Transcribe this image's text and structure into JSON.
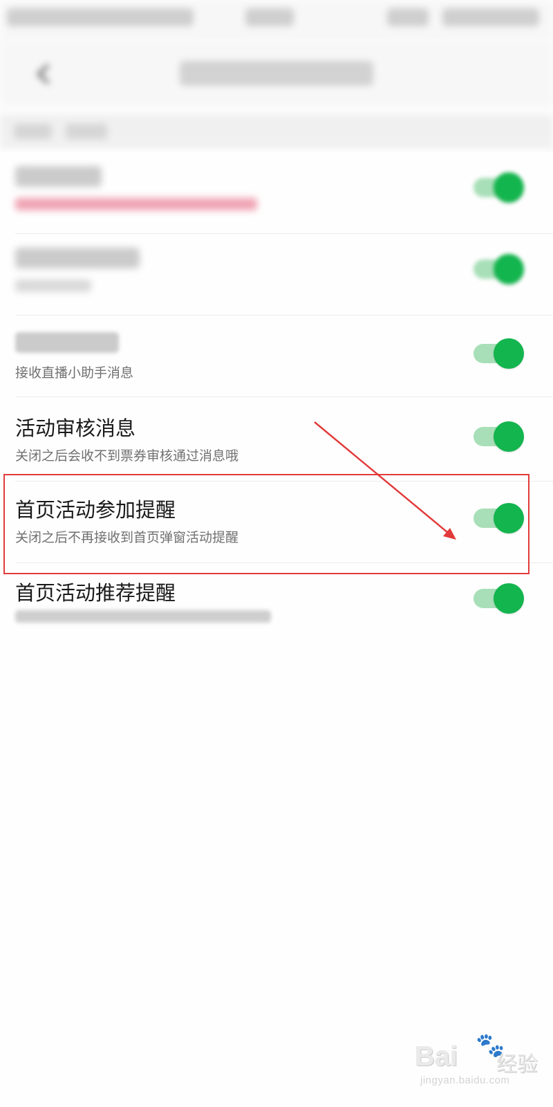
{
  "rows": [
    {
      "title": "活动审核消息",
      "subtitle": "关闭之后会收不到票券审核通过消息哦",
      "enabled": true
    },
    {
      "title": "首页活动参加提醒",
      "subtitle": "关闭之后不再接收到首页弹窗活动提醒",
      "enabled": true
    },
    {
      "title": "首页活动推荐提醒",
      "enabled": true
    }
  ],
  "partial_row": {
    "subtitle": "接收直播小助手消息",
    "enabled": true
  },
  "blurred_rows": [
    {
      "enabled": true
    },
    {
      "enabled": true
    }
  ],
  "watermark": {
    "logo": "Bai",
    "brand": "经验",
    "url": "jingyan.baidu.com"
  },
  "colors": {
    "toggle_on": "#13b54e",
    "toggle_track": "#a8dfb8",
    "annotation": "#e23a3a"
  }
}
